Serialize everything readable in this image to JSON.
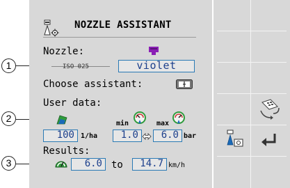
{
  "window": {
    "title": "NOZZLE ASSISTANT",
    "title_icon": "nozzle-gear-icon"
  },
  "callouts": [
    "1",
    "2",
    "3"
  ],
  "nozzle": {
    "label": "Nozzle:",
    "standard": "ISO 025",
    "value": "violet",
    "color_hex": "#8a1fb5"
  },
  "assistant": {
    "label": "Choose assistant:",
    "icon": "calculator-switch-icon"
  },
  "user_data": {
    "label": "User data:",
    "rate_icon": "field-area-icon",
    "rate_value": "100",
    "rate_unit": "1/ha",
    "min_label": "min",
    "max_label": "max",
    "min_value": "1.0",
    "max_value": "6.0",
    "pressure_unit": "bar",
    "link_icon": "swap-arrows-icon"
  },
  "results": {
    "label": "Results:",
    "icon": "speedometer-icon",
    "from": "6.0",
    "to_word": "to",
    "to": "14.7",
    "unit": "km/h"
  },
  "softkeys": {
    "items": [
      {
        "icon": "calculator-switch-icon"
      },
      {
        "icon": "nozzle-settings-icon"
      },
      {
        "icon": "return-arrow-icon"
      }
    ]
  },
  "colors": {
    "panel_bg": "#d8d8d8",
    "field_border": "#2a7ab5",
    "field_text": "#1c3f8c",
    "accent_green": "#2f9b3c",
    "accent_blue": "#1a6ab8"
  }
}
